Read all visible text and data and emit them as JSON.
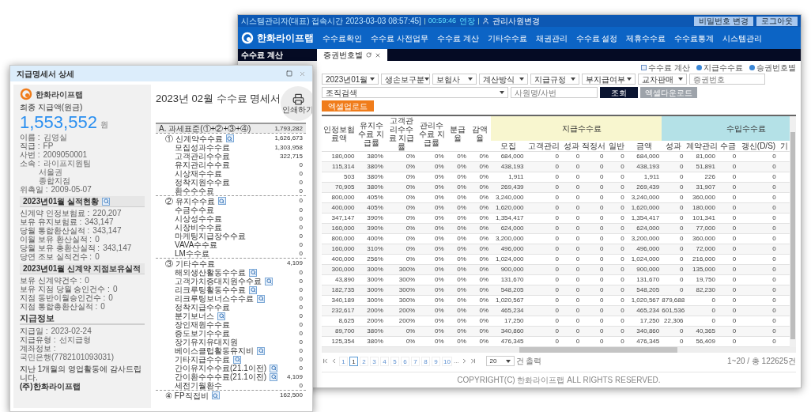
{
  "app": {
    "session_bar": {
      "text": "시스템관리자(대표) 접속시간 2023-03-03 08:57:45]",
      "timer": "00:59:46",
      "extend": "연장",
      "switch_user": "관리사원변경",
      "buttons": [
        "비밀번호 변경",
        "로그아웃"
      ]
    },
    "logo": "한화라이프랩",
    "menu": [
      "수수료확인",
      "수수료 사전업무",
      "수수료 계산",
      "기타수수료",
      "채권관리",
      "수수료 설정",
      "제휴수수료",
      "수수료통계",
      "시스템관리"
    ],
    "section_label": "수수료 계산",
    "tabs": [
      {
        "label": "증권번호별",
        "selected": true
      }
    ],
    "legend": [
      {
        "kind": "help",
        "label": "수수료 계산"
      },
      {
        "kind": "dot",
        "label": "지급수수료"
      },
      {
        "kind": "dot",
        "label": "승권번호별"
      }
    ],
    "filters": [
      {
        "kind": "select",
        "value": "2023년01월"
      },
      {
        "kind": "select",
        "value": "생손보구분"
      },
      {
        "kind": "select",
        "value": "보험사"
      },
      {
        "kind": "select",
        "value": "계산방식"
      },
      {
        "kind": "select",
        "value": "지급규정"
      },
      {
        "kind": "select",
        "value": "부지급여부"
      },
      {
        "kind": "select",
        "value": "교차판매"
      },
      {
        "kind": "input",
        "placeholder": "증권번호"
      }
    ],
    "filters_2": [
      {
        "kind": "select",
        "value": "조직검색"
      },
      {
        "kind": "input",
        "placeholder": "사원명/사번"
      }
    ],
    "search_button": "조회",
    "download_button": "엑셀다운로드",
    "upload_button": "엑셀업로드",
    "table": {
      "lead_columns": [
        "인정보험료액",
        "유지수수료 지급률",
        "고객관리수수료 지급률",
        "관리수수료 지급률",
        "분급율",
        "감액율"
      ],
      "groups": [
        {
          "label": "지급수수료",
          "color": "#f8f6cf",
          "columns": [
            "모집",
            "고객관리",
            "성과",
            "적정서",
            "일반",
            "금액"
          ]
        },
        {
          "label": "수입수수료",
          "color": "#b4e1e7",
          "columns": [
            "성과",
            "계약관리",
            "수금",
            "갱신(D/S)",
            "기"
          ]
        }
      ],
      "rows": [
        [
          "180,000",
          "380%",
          "0%",
          "0%",
          "0%",
          "0%",
          "684,000",
          "0",
          "0",
          "0",
          "0",
          "684,000",
          "0",
          "81,000",
          "0",
          "0"
        ],
        [
          "115,314",
          "380%",
          "0%",
          "0%",
          "0%",
          "0%",
          "438,193",
          "0",
          "0",
          "0",
          "0",
          "438,193",
          "0",
          "51,891",
          "0",
          "0"
        ],
        [
          "503",
          "380%",
          "0%",
          "0%",
          "0%",
          "0%",
          "1,911",
          "0",
          "0",
          "0",
          "0",
          "1,911",
          "0",
          "226",
          "0",
          "0"
        ],
        [
          "70,905",
          "380%",
          "0%",
          "0%",
          "0%",
          "0%",
          "269,439",
          "0",
          "0",
          "0",
          "0",
          "269,439",
          "0",
          "31,907",
          "0",
          "0"
        ],
        [
          "800,000",
          "405%",
          "0%",
          "0%",
          "0%",
          "0%",
          "3,240,000",
          "0",
          "0",
          "0",
          "0",
          "3,240,000",
          "0",
          "360,000",
          "0",
          "0"
        ],
        [
          "400,000",
          "405%",
          "0%",
          "0%",
          "0%",
          "0%",
          "1,620,000",
          "0",
          "0",
          "0",
          "0",
          "1,620,000",
          "0",
          "180,000",
          "0",
          "0"
        ],
        [
          "347,147",
          "390%",
          "0%",
          "0%",
          "0%",
          "0%",
          "1,354,417",
          "0",
          "0",
          "0",
          "0",
          "1,354,417",
          "0",
          "101,341",
          "0",
          "0"
        ],
        [
          "160,000",
          "390%",
          "0%",
          "0%",
          "0%",
          "0%",
          "624,000",
          "0",
          "0",
          "0",
          "0",
          "624,000",
          "0",
          "77,000",
          "0",
          "0"
        ],
        [
          "800,000",
          "400%",
          "0%",
          "0%",
          "0%",
          "0%",
          "3,200,000",
          "0",
          "0",
          "0",
          "0",
          "3,200,000",
          "0",
          "360,000",
          "0",
          "0"
        ],
        [
          "160,000",
          "310%",
          "0%",
          "0%",
          "0%",
          "0%",
          "496,000",
          "0",
          "0",
          "0",
          "0",
          "496,000",
          "0",
          "72,000",
          "0",
          "0"
        ],
        [
          "400,000",
          "256%",
          "0%",
          "0%",
          "0%",
          "0%",
          "1,024,000",
          "0",
          "0",
          "0",
          "0",
          "1,024,000",
          "0",
          "216,000",
          "0",
          "0"
        ],
        [
          "300,000",
          "300%",
          "300%",
          "0%",
          "0%",
          "0%",
          "900,000",
          "0",
          "0",
          "0",
          "0",
          "900,000",
          "0",
          "135,000",
          "0",
          "0"
        ],
        [
          "43,890",
          "300%",
          "300%",
          "0%",
          "0%",
          "0%",
          "131,670",
          "0",
          "0",
          "0",
          "0",
          "131,670",
          "0",
          "19,750",
          "0",
          "0"
        ],
        [
          "182,735",
          "300%",
          "300%",
          "0%",
          "0%",
          "0%",
          "548,205",
          "0",
          "0",
          "0",
          "0",
          "548,205",
          "0",
          "82,230",
          "0",
          "0"
        ],
        [
          "340,189",
          "300%",
          "300%",
          "0%",
          "0%",
          "0%",
          "1,020,567",
          "0",
          "0",
          "0",
          "0",
          "1,020,567",
          "879,688",
          "0",
          "0",
          "0"
        ],
        [
          "232,617",
          "200%",
          "200%",
          "0%",
          "0%",
          "0%",
          "465,234",
          "0",
          "0",
          "0",
          "0",
          "465,234",
          "601,536",
          "0",
          "0",
          "0"
        ],
        [
          "8,625",
          "200%",
          "200%",
          "0%",
          "0%",
          "0%",
          "17,250",
          "0",
          "0",
          "0",
          "0",
          "17,250",
          "22,306",
          "0",
          "0",
          "0"
        ],
        [
          "89,700",
          "380%",
          "0%",
          "0%",
          "0%",
          "0%",
          "340,860",
          "0",
          "0",
          "0",
          "0",
          "340,860",
          "0",
          "40,365",
          "0",
          "0"
        ],
        [
          "125,354",
          "380%",
          "0%",
          "0%",
          "0%",
          "0%",
          "476,345",
          "0",
          "0",
          "0",
          "0",
          "476,345",
          "0",
          "56,409",
          "0",
          "0"
        ]
      ]
    },
    "pagination": {
      "pages": [
        {
          "label": "1",
          "selected": false
        },
        {
          "label": "1",
          "selected": true
        },
        {
          "label": "2",
          "selected": false
        },
        {
          "label": "3",
          "selected": false
        },
        {
          "label": "4",
          "selected": false
        },
        {
          "label": "5",
          "selected": false
        },
        {
          "label": "6",
          "selected": false
        },
        {
          "label": "7",
          "selected": false
        },
        {
          "label": "8",
          "selected": false
        },
        {
          "label": "9",
          "selected": false
        },
        {
          "label": "10",
          "selected": false
        }
      ],
      "ellipsis": "...",
      "page_size": "20",
      "page_size_suffix": "건 출력",
      "summary": "1~20 / 총 122625건"
    },
    "footer": "COPYRIGHT(C) 한화라이프랩 ALL RIGHTS RESERVED."
  },
  "statement": {
    "title": "지급명세서 상세",
    "logo": "한화라이프랩",
    "final_label": "최종 지급액(원금)",
    "final_amount": "1,553,552",
    "currency": "원",
    "profile": [
      {
        "label": "이름 :",
        "value": "김영실"
      },
      {
        "label": "직급 :",
        "value": "FP"
      },
      {
        "label": "사번 :",
        "value": "2009050001"
      },
      {
        "label": "소속 :",
        "value": "라이프지원팀"
      },
      {
        "value": "서울권"
      },
      {
        "value": "종합지점"
      },
      {
        "label": "위촉일 :",
        "value": "2009-05-07"
      }
    ],
    "sections": [
      {
        "kind": "boxed",
        "title": "2023년01월 실적현황",
        "search": true,
        "rows": [
          {
            "label": "신계약 인정보험료 :",
            "value": "220,207"
          },
          {
            "label": "보유 유지보험료 :",
            "value": "343,147"
          },
          {
            "label": "당월 통합환산실적 :",
            "value": "343,147"
          },
          {
            "label": "이월 보유 환산실적 :",
            "value": "0"
          },
          {
            "label": "당월 보유 총환산실적 :",
            "value": "343,147"
          },
          {
            "label": "당연 조보 실적건수 :",
            "value": "0"
          }
        ]
      },
      {
        "kind": "boxed",
        "title": "2023년01월 신계약 지점보유실적",
        "search": false,
        "rows": [
          {
            "label": "보유 신계약건수 :",
            "value": "0"
          },
          {
            "label": "보유 지점 당월 승인건수 :",
            "value": "0"
          },
          {
            "label": "지점 동반이월승인건수 :",
            "value": "0"
          },
          {
            "label": "지점 통합총환산실적 :",
            "value": "0"
          }
        ]
      },
      {
        "kind": "plain",
        "title": "지급정보",
        "search": false,
        "rows": [
          {
            "label": "지급일 :",
            "value": "2023-02-24"
          },
          {
            "label": "지급유형 :",
            "value": "선지급형"
          },
          {
            "label": "계좌정보 :",
            "value": "국민은행(7782101093031)"
          }
        ]
      }
    ],
    "message": [
      "지난 1개월의 영업활동에 감사드립니다.",
      "(주)한화라이프랩"
    ],
    "heading": "2023년 02월 수수료 명세서",
    "print_label": "인쇄하기",
    "total": {
      "label": "A. 과세표준(①+②+③+④)",
      "value": "1,793,282"
    },
    "groups": [
      {
        "label": "① 신계약수수료",
        "value": "1,626,673",
        "search": true,
        "children": [
          {
            "label": "모집성과수수료",
            "value": "1,303,958",
            "search": false
          },
          {
            "label": "고객관리수수료",
            "value": "322,715",
            "search": false
          },
          {
            "label": "유지관리수수료",
            "value": "0",
            "search": false
          },
          {
            "label": "시상재수수료",
            "value": "0",
            "search": false
          },
          {
            "label": "정착지원수수료",
            "value": "0",
            "search": false
          },
          {
            "label": "환수수수료",
            "value": "0",
            "search": false
          }
        ]
      },
      {
        "label": "② 유지수수료",
        "value": "0",
        "search": true,
        "children": [
          {
            "label": "수금수수료",
            "value": "0",
            "search": false
          },
          {
            "label": "시상성수수료",
            "value": "0",
            "search": false
          },
          {
            "label": "시장비수수료",
            "value": "0",
            "search": false
          },
          {
            "label": "마케팅지급장수수료",
            "value": "0",
            "search": false
          },
          {
            "label": "VAVA수수료",
            "value": "0",
            "search": false
          },
          {
            "label": "LM수수료",
            "value": "0",
            "search": false
          }
        ]
      },
      {
        "label": "③ 기타수수료",
        "value": "4,109",
        "search": false,
        "children": [
          {
            "label": "해외생산활동수수료",
            "value": "0",
            "search": true
          },
          {
            "label": "고객가치증대지원수수료",
            "value": "0",
            "search": true
          },
          {
            "label": "리크루팅활동수수료",
            "value": "0",
            "search": true
          },
          {
            "label": "리크루팅보너스수수료",
            "value": "0",
            "search": true
          },
          {
            "label": "정착지급수수료",
            "value": "0",
            "search": false
          },
          {
            "label": "분기보너스",
            "value": "0",
            "search": true
          },
          {
            "label": "장인재원수수료",
            "value": "0",
            "search": false
          },
          {
            "label": "증도보기수수료",
            "value": "0",
            "search": false
          },
          {
            "label": "장기유지유대지원",
            "value": "0",
            "search": false
          },
          {
            "label": "베이스클럽활동유지비",
            "value": "0",
            "search": true
          },
          {
            "label": "기타지급수수료",
            "value": "0",
            "search": true
          },
          {
            "label": "간이유지수수료(21.1이전)",
            "value": "0",
            "search": true
          },
          {
            "label": "간이환수수수료(21.1이전)",
            "value": "4,109",
            "search": true
          },
          {
            "label": "세전기월환수",
            "value": "0",
            "search": false
          }
        ]
      },
      {
        "label": "④ FP직접비",
        "value": "162,500",
        "search": true
      }
    ]
  }
}
